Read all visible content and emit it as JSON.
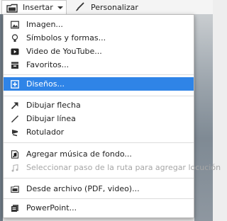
{
  "toolbar": {
    "insert_label": "Insertar",
    "personalize_label": "Personalizar",
    "insert_icon": "folder-insert-icon",
    "personalize_icon": "brush-icon"
  },
  "menu": {
    "items": [
      {
        "label": "Imagen...",
        "icon": "image-icon",
        "state": "normal"
      },
      {
        "label": "Símbolos y formas...",
        "icon": "bulb-icon",
        "state": "normal"
      },
      {
        "label": "Video de YouTube...",
        "icon": "youtube-icon",
        "state": "normal"
      },
      {
        "label": "Favoritos...",
        "icon": "favorites-icon",
        "state": "normal"
      },
      {
        "label": "Diseños...",
        "icon": "layouts-icon",
        "state": "selected"
      },
      {
        "label": "Dibujar flecha",
        "icon": "arrow-icon",
        "state": "normal"
      },
      {
        "label": "Dibujar línea",
        "icon": "line-icon",
        "state": "normal"
      },
      {
        "label": "Rotulador",
        "icon": "marker-icon",
        "state": "normal"
      },
      {
        "label": "Agregar música de fondo...",
        "icon": "music-file-icon",
        "state": "normal"
      },
      {
        "label": "Seleccionar paso de la ruta para agregar locución",
        "icon": "music-note-icon",
        "state": "disabled"
      },
      {
        "label": "Desde archivo (PDF, video)...",
        "icon": "folder-icon",
        "state": "normal"
      },
      {
        "label": "PowerPoint...",
        "icon": "powerpoint-icon",
        "state": "normal"
      }
    ]
  },
  "colors": {
    "selected_bg": "#2f84e7",
    "disabled_text": "#a6a6a6"
  }
}
